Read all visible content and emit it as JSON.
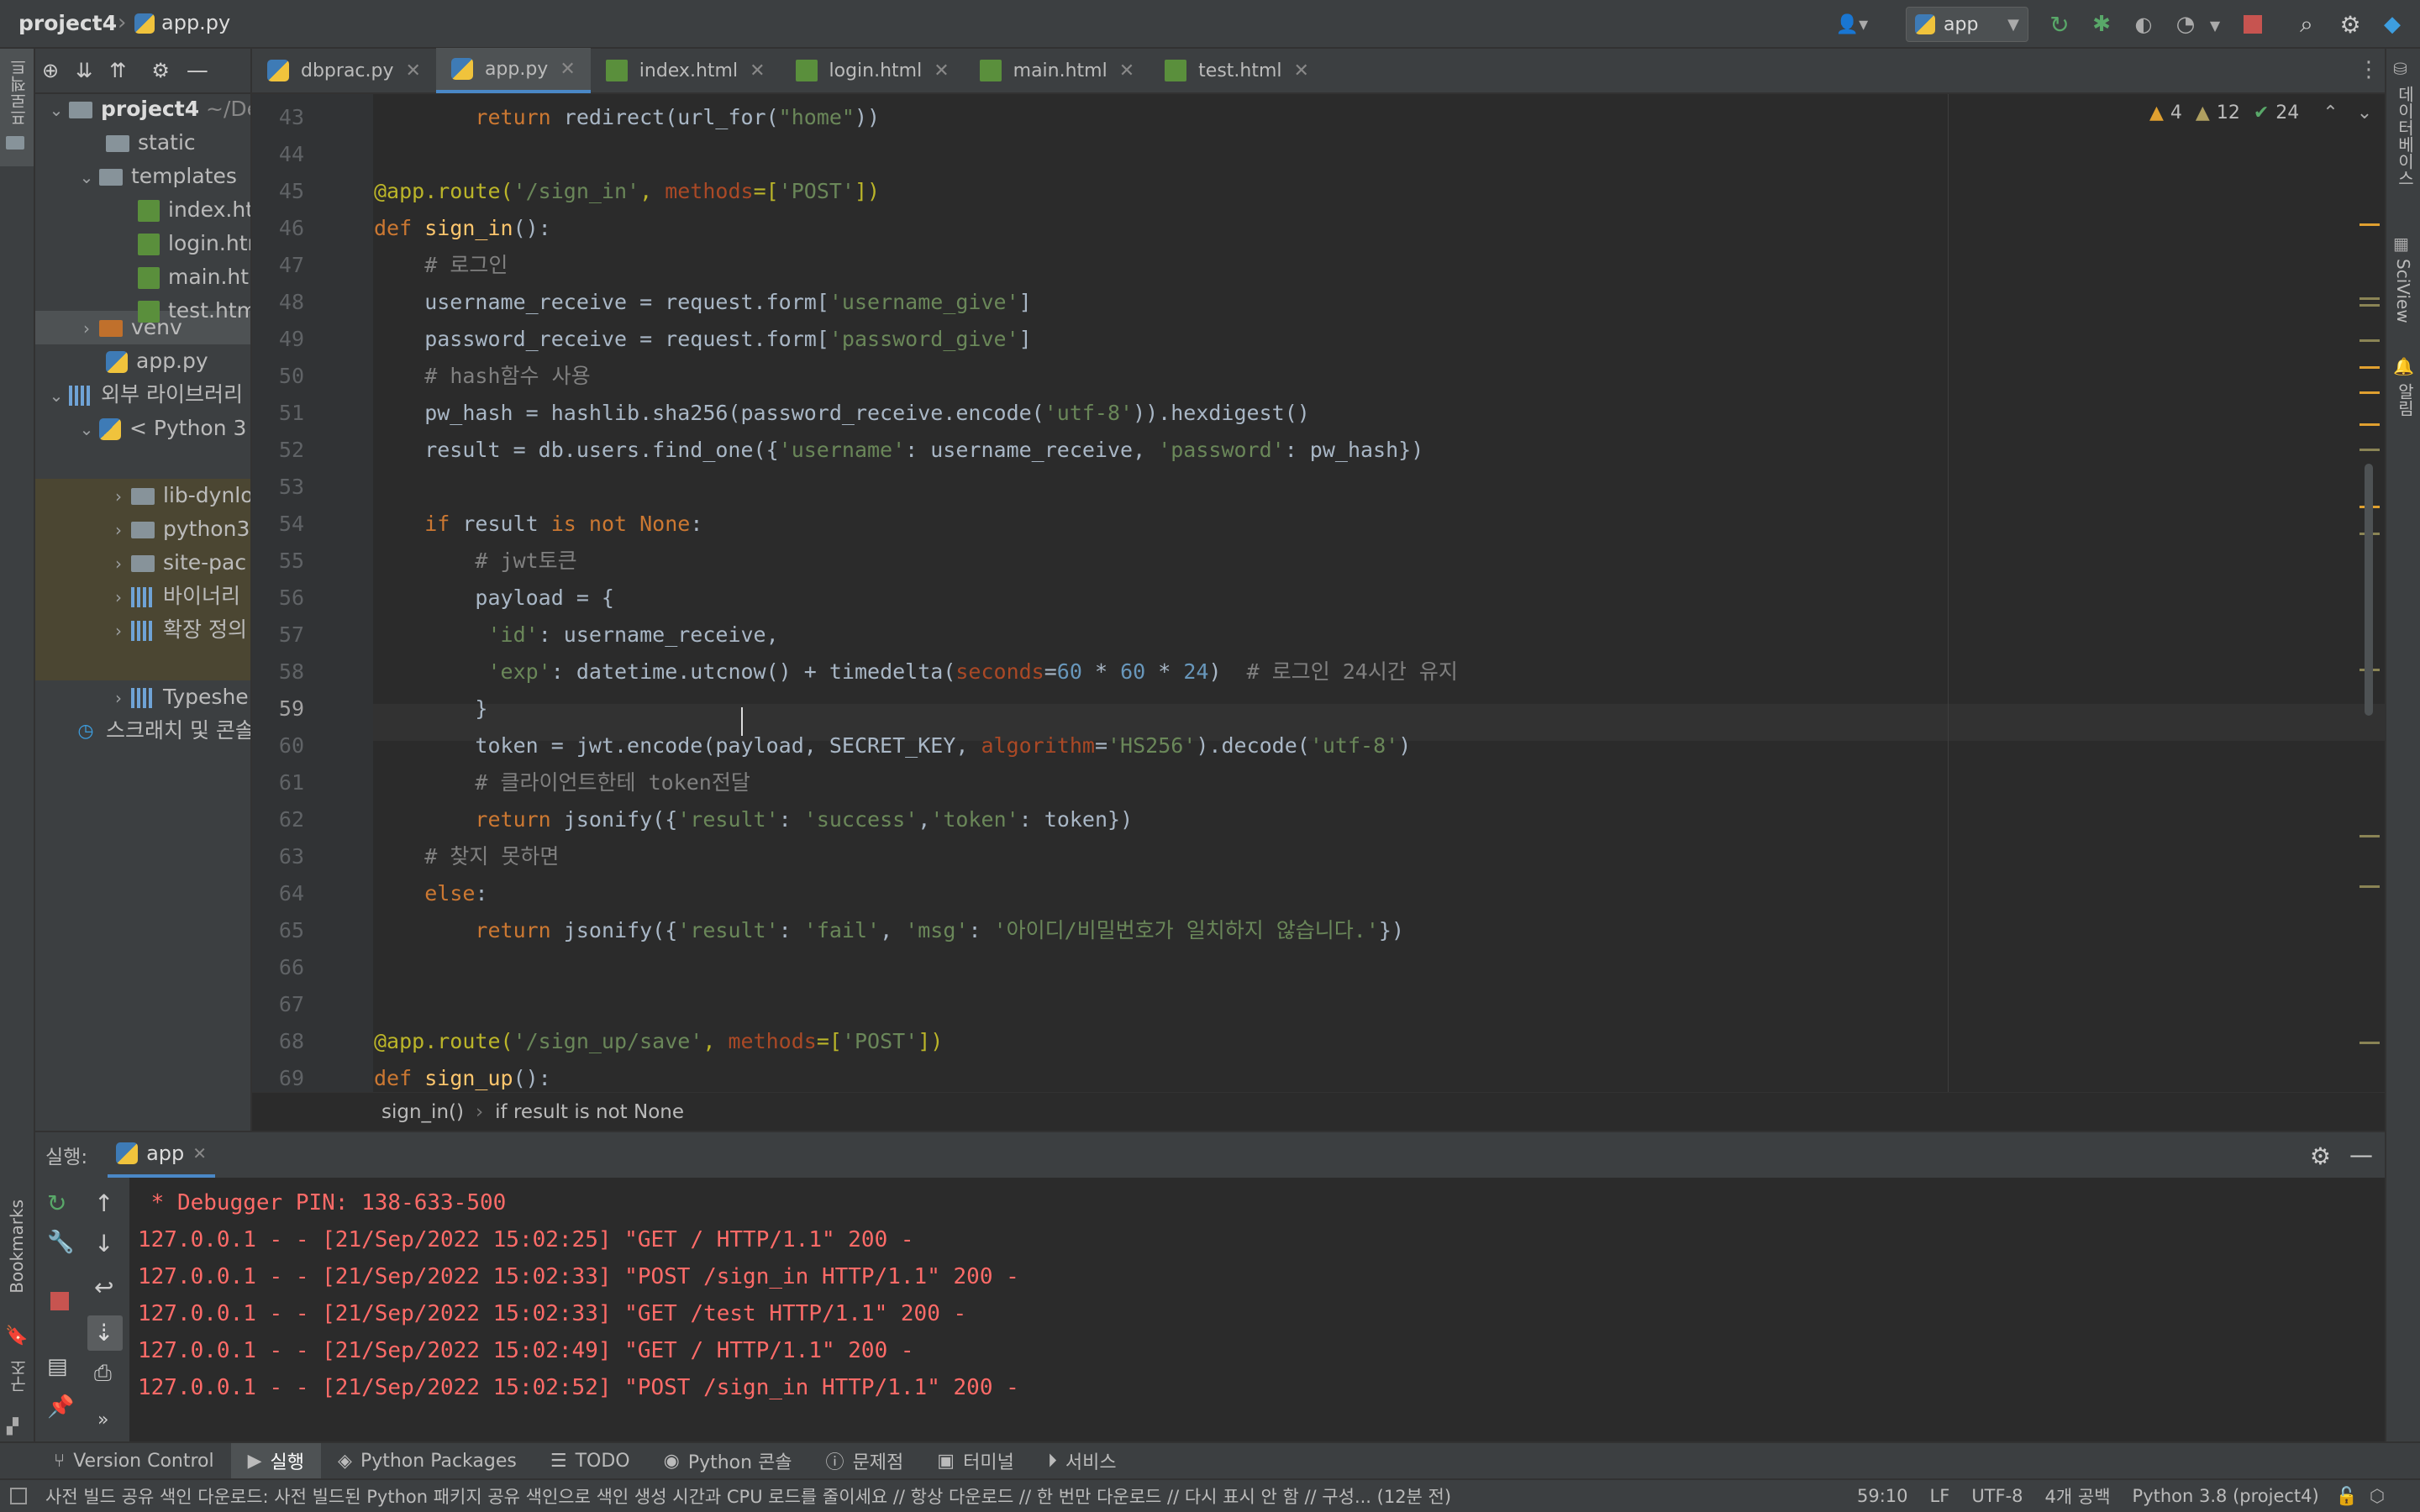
{
  "nav": {
    "project": "project4",
    "file": "app.py",
    "run_config": "app"
  },
  "left_strip": {
    "project": "프로젝트",
    "bookmarks": "Bookmarks",
    "structure": "구조"
  },
  "right_strip": {
    "database": "데이터베이스",
    "sciview": "SciView",
    "notifications": "알림"
  },
  "tabs": [
    {
      "label": "dbprac.py"
    },
    {
      "label": "app.py"
    },
    {
      "label": "index.html"
    },
    {
      "label": "login.html"
    },
    {
      "label": "main.html"
    },
    {
      "label": "test.html"
    }
  ],
  "tree": {
    "project": "project4",
    "project_path": "~/De",
    "static": "static",
    "templates": "templates",
    "index": "index.ht",
    "login": "login.htr",
    "main": "main.htr",
    "test": "test.htm",
    "venv": "venv",
    "app": "app.py",
    "ext_libs": "외부 라이브러리",
    "python": "< Python 3",
    "lib_dyn": "lib-dynlo",
    "python3": "python3",
    "site_pack": "site-pac",
    "binary": "바이너리 ",
    "ext_def": "확장 정의",
    "typeshed": "Typeshe",
    "scratch": "스크래치 및 콘솔"
  },
  "inspection": {
    "warnings": "4",
    "weak_warnings": "12",
    "ok": "24"
  },
  "code_lines": [
    {
      "n": "43",
      "html": "        <span class=\"kw\">return</span> redirect(url_for(<span class=\"str\">\"home\"</span>))"
    },
    {
      "n": "44",
      "html": ""
    },
    {
      "n": "45",
      "html": "<span class=\"dec\">@app.route(</span><span class=\"str\">'/sign_in'</span><span class=\"dec\">, </span><span class=\"pm\">methods</span><span class=\"dec\">=[</span><span class=\"str\">'POST'</span><span class=\"dec\">])</span>"
    },
    {
      "n": "46",
      "html": "<span class=\"kw\">def</span> <span class=\"fn\">sign_in</span>():"
    },
    {
      "n": "47",
      "html": "    <span class=\"cmt\"># 로그인</span>"
    },
    {
      "n": "48",
      "html": "    username_receive = request.form[<span class=\"str\">'username_give'</span>]"
    },
    {
      "n": "49",
      "html": "    password_receive = request.form[<span class=\"str\">'password_give'</span>]"
    },
    {
      "n": "50",
      "html": "    <span class=\"cmt\"># hash함수 사용</span>"
    },
    {
      "n": "51",
      "html": "    pw_hash = hashlib.sha256(password_receive.encode(<span class=\"str\">'utf-8'</span>)).hexdigest()"
    },
    {
      "n": "52",
      "html": "    result = db.users.find_one({<span class=\"str\">'username'</span>: username_receive, <span class=\"str\">'password'</span>: pw_hash})"
    },
    {
      "n": "53",
      "html": ""
    },
    {
      "n": "54",
      "html": "    <span class=\"kw\">if</span> result <span class=\"kw\">is not None</span>:"
    },
    {
      "n": "55",
      "html": "        <span class=\"cmt\"># jwt토큰</span>"
    },
    {
      "n": "56",
      "html": "        payload = {"
    },
    {
      "n": "57",
      "html": "         <span class=\"str\">'id'</span>: username_receive,"
    },
    {
      "n": "58",
      "html": "         <span class=\"str\">'exp'</span>: datetime.utcnow() + timedelta(<span class=\"pm\">seconds</span>=<span class=\"num\">60</span> * <span class=\"num\">60</span> * <span class=\"num\">24</span>)  <span class=\"cmt\"># 로그인 24시간 유지</span>"
    },
    {
      "n": "59",
      "html": "        }"
    },
    {
      "n": "60",
      "html": "        token = jwt.encode(payload, SECRET_KEY, <span class=\"pm\">algorithm</span>=<span class=\"str\">'HS256'</span>).decode(<span class=\"str\">'utf-8'</span>)"
    },
    {
      "n": "61",
      "html": "        <span class=\"cmt\"># 클라이언트한테 token전달</span>"
    },
    {
      "n": "62",
      "html": "        <span class=\"kw\">return</span> jsonify({<span class=\"str\">'result'</span>: <span class=\"str\">'success'</span>,<span class=\"str\">'token'</span>: token})"
    },
    {
      "n": "63",
      "html": "    <span class=\"cmt\"># 찾지 못하면</span>"
    },
    {
      "n": "64",
      "html": "    <span class=\"kw\">else</span>:"
    },
    {
      "n": "65",
      "html": "        <span class=\"kw\">return</span> jsonify({<span class=\"str\">'result'</span>: <span class=\"str\">'fail'</span>, <span class=\"str\">'msg'</span>: <span class=\"str\">'아이디/비밀번호가 일치하지 않습니다.'</span>})"
    },
    {
      "n": "66",
      "html": ""
    },
    {
      "n": "67",
      "html": ""
    },
    {
      "n": "68",
      "html": "<span class=\"dec\">@app.route(</span><span class=\"str\">'/sign_up/save'</span><span class=\"dec\">, </span><span class=\"pm\">methods</span><span class=\"dec\">=[</span><span class=\"str\">'POST'</span><span class=\"dec\">])</span>"
    },
    {
      "n": "69",
      "html": "<span class=\"kw\">def</span> <span class=\"fn\">sign_up</span>():"
    }
  ],
  "breadcrumb": {
    "fn": "sign_in()",
    "block": "if result is not None"
  },
  "run": {
    "label": "실행:",
    "tab": "app"
  },
  "console": [
    " * Debugger PIN: 138-633-500",
    "127.0.0.1 - - [21/Sep/2022 15:02:25] \"GET / HTTP/1.1\" 200 -",
    "127.0.0.1 - - [21/Sep/2022 15:02:33] \"POST /sign_in HTTP/1.1\" 200 -",
    "127.0.0.1 - - [21/Sep/2022 15:02:33] \"GET /test HTTP/1.1\" 200 -",
    "127.0.0.1 - - [21/Sep/2022 15:02:49] \"GET / HTTP/1.1\" 200 -",
    "127.0.0.1 - - [21/Sep/2022 15:02:52] \"POST /sign_in HTTP/1.1\" 200 -"
  ],
  "toolwindows": {
    "vcs": "Version Control",
    "run": "실행",
    "packages": "Python Packages",
    "todo": "TODO",
    "console": "Python 콘솔",
    "problems": "문제점",
    "terminal": "터미널",
    "services": "서비스"
  },
  "status": {
    "message": "사전 빌드 공유 색인 다운로드: 사전 빌드된 Python 패키지 공유 색인으로 색인 생성 시간과 CPU 로드를 줄이세요 // 항상 다운로드 // 한 번만 다운로드 // 다시 표시 안 함 // 구성... (12분 전)",
    "position": "59:10",
    "line_sep": "LF",
    "encoding": "UTF-8",
    "indent": "4개 공백",
    "interpreter": "Python 3.8 (project4)"
  },
  "colors": {
    "accent": "#4a88c7",
    "error": "#ff6b68",
    "warning": "#e0a030"
  }
}
